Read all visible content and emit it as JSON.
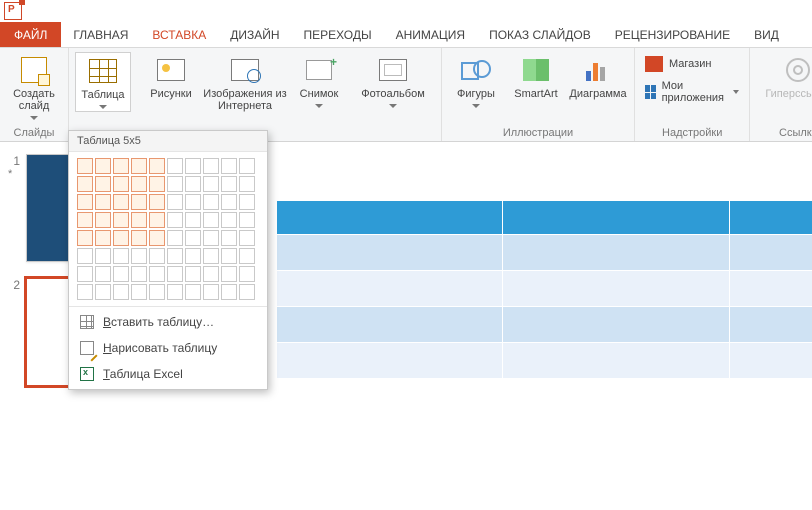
{
  "tabs": {
    "file": "ФАЙЛ",
    "home": "ГЛАВНАЯ",
    "insert": "ВСТАВКА",
    "design": "ДИЗАЙН",
    "transitions": "ПЕРЕХОДЫ",
    "animation": "АНИМАЦИЯ",
    "slideshow": "ПОКАЗ СЛАЙДОВ",
    "review": "РЕЦЕНЗИРОВАНИЕ",
    "view": "ВИД"
  },
  "groups": {
    "slides": "Слайды",
    "illustrations": "Иллюстрации",
    "addins": "Надстройки",
    "links": "Ссылки"
  },
  "buttons": {
    "new_slide": "Создать слайд",
    "table": "Таблица",
    "pictures": "Рисунки",
    "online_images": "Изображения из Интернета",
    "screenshot": "Снимок",
    "photo_album": "Фотоальбом",
    "shapes": "Фигуры",
    "smartart": "SmartArt",
    "chart": "Диаграмма",
    "store": "Магазин",
    "my_apps": "Мои приложения",
    "hyperlink": "Гиперссылка"
  },
  "dropdown": {
    "title": "Таблица 5x5",
    "grid_rows": 8,
    "grid_cols": 10,
    "selected_rows": 5,
    "selected_cols": 5,
    "insert_table": "Вставить таблицу…",
    "draw_table": "Нарисовать таблицу",
    "excel_table": "Таблица Excel"
  },
  "thumbnails": [
    {
      "index": "1",
      "marker": "*",
      "selected": false,
      "blue": true
    },
    {
      "index": "2",
      "marker": "",
      "selected": true,
      "blue": false
    }
  ],
  "preview_table": {
    "cols": 3,
    "rows": 5
  }
}
